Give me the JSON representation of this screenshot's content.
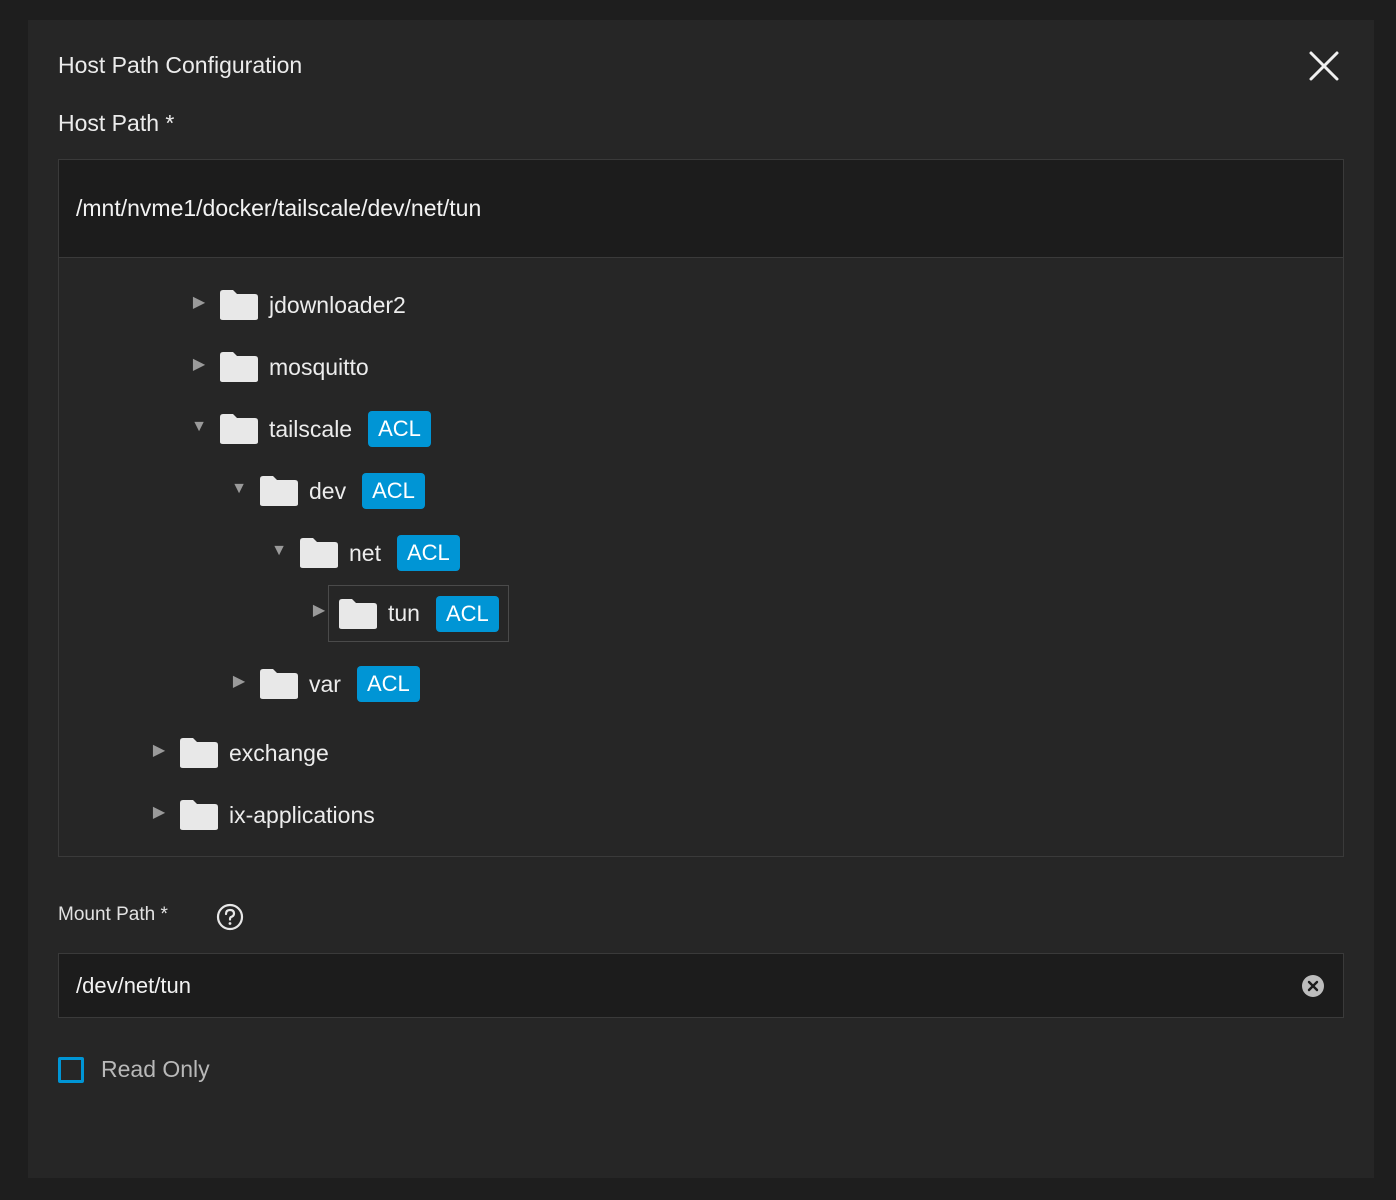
{
  "dialog": {
    "title": "Host Path Configuration"
  },
  "host_path": {
    "label": "Host Path *",
    "value": "/mnt/nvme1/docker/tailscale/dev/net/tun"
  },
  "tree": {
    "nodes": [
      {
        "label": "jdownloader2",
        "expanded": false,
        "acl": ""
      },
      {
        "label": "mosquitto",
        "expanded": false,
        "acl": ""
      },
      {
        "label": "tailscale",
        "expanded": true,
        "acl": "ACL"
      },
      {
        "label": "dev",
        "expanded": true,
        "acl": "ACL"
      },
      {
        "label": "net",
        "expanded": true,
        "acl": "ACL"
      },
      {
        "label": "tun",
        "expanded": false,
        "acl": "ACL",
        "selected": true
      },
      {
        "label": "var",
        "expanded": false,
        "acl": "ACL"
      },
      {
        "label": "exchange",
        "expanded": false,
        "acl": ""
      },
      {
        "label": "ix-applications",
        "expanded": false,
        "acl": ""
      }
    ]
  },
  "mount_path": {
    "label": "Mount Path *",
    "value": "/dev/net/tun"
  },
  "read_only": {
    "label": "Read Only",
    "checked": false
  },
  "colors": {
    "accent": "#0095d5",
    "background": "#262626",
    "input_background": "#1c1c1c"
  },
  "icons": {
    "close": "close-icon",
    "folder": "folder-icon",
    "help": "help-circle-icon",
    "clear": "clear-circle-icon",
    "collapsed": "triangle-right-icon",
    "expanded": "triangle-down-icon"
  }
}
